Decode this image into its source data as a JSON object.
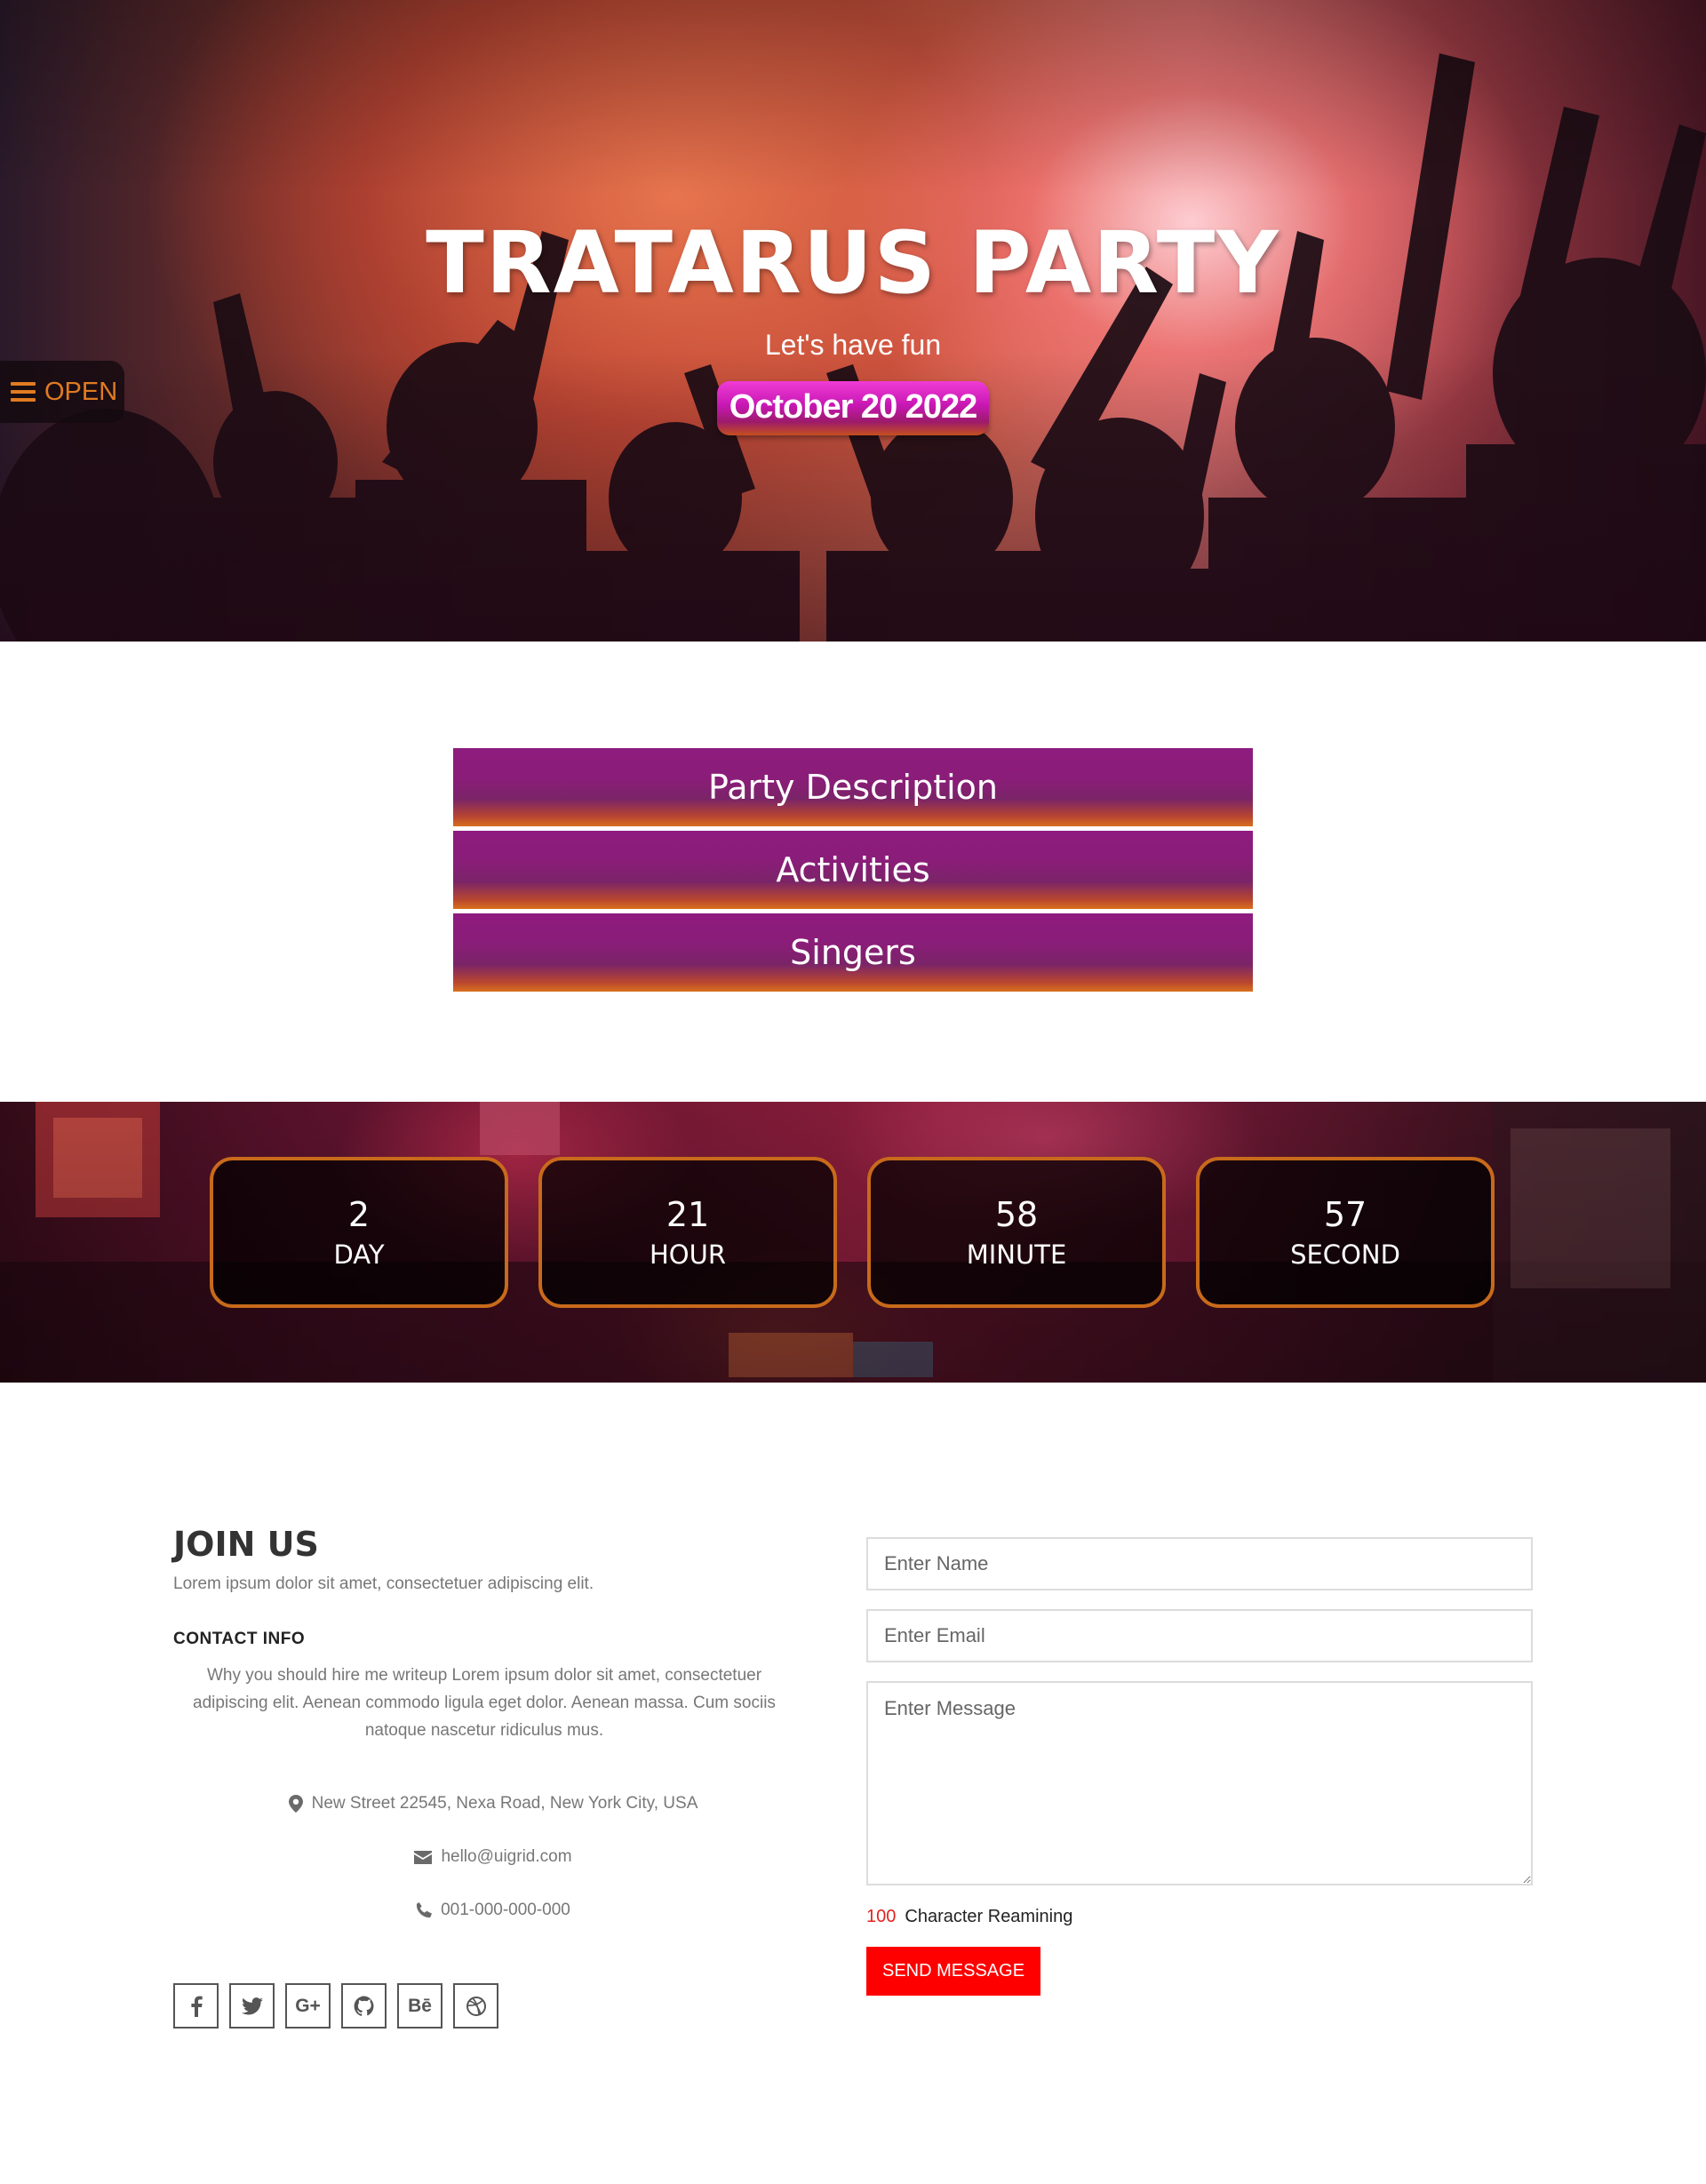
{
  "hero": {
    "title": "TRATARUS PARTY",
    "subtitle": "Let's have fun",
    "date": "October 20 2022",
    "menu_label": "OPEN"
  },
  "accordion": {
    "items": [
      {
        "label": "Party Description"
      },
      {
        "label": "Activities"
      },
      {
        "label": "Singers"
      }
    ]
  },
  "countdown": {
    "units": [
      {
        "value": "2",
        "label": "DAY"
      },
      {
        "value": "21",
        "label": "HOUR"
      },
      {
        "value": "58",
        "label": "MINUTE"
      },
      {
        "value": "57",
        "label": "SECOND"
      }
    ]
  },
  "join": {
    "title": "JOIN US",
    "intro": "Lorem ipsum dolor sit amet, consectetuer adipiscing elit.",
    "contact_title": "CONTACT INFO",
    "contact_desc": "Why you should hire me writeup Lorem ipsum dolor sit amet, consectetuer adipiscing elit. Aenean commodo ligula eget dolor. Aenean massa. Cum sociis natoque nascetur ridiculus mus.",
    "address": "New Street 22545, Nexa Road, New York City, USA",
    "email": "hello@uigrid.com",
    "phone": "001-000-000-000",
    "social": [
      {
        "icon": "facebook-icon"
      },
      {
        "icon": "twitter-icon"
      },
      {
        "icon": "google-plus-icon",
        "text": "G+"
      },
      {
        "icon": "github-icon"
      },
      {
        "icon": "behance-icon",
        "text": "Bē"
      },
      {
        "icon": "dribbble-icon"
      }
    ]
  },
  "form": {
    "name_placeholder": "Enter Name",
    "email_placeholder": "Enter Email",
    "message_placeholder": "Enter Message",
    "char_count": "100",
    "char_label": "Character Reamining",
    "submit_label": "SEND MESSAGE"
  },
  "colors": {
    "accent_orange": "#e07b21",
    "accordion_purple": "#8e1b7f",
    "countdown_border": "#c86a1b",
    "send_button": "#ff0000"
  }
}
